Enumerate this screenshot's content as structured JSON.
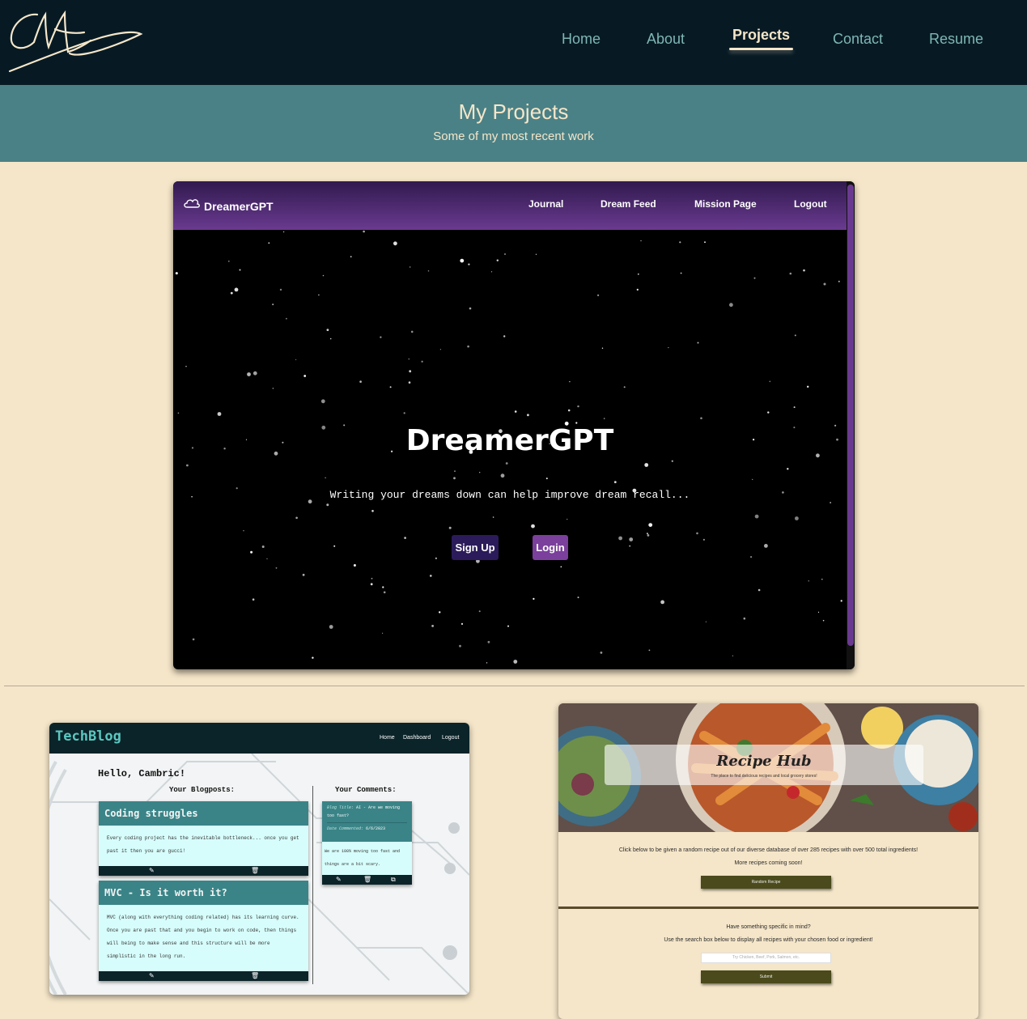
{
  "nav": {
    "logo_alt": "CM",
    "links": [
      {
        "label": "Home"
      },
      {
        "label": "About"
      },
      {
        "label": "Projects",
        "active": true
      },
      {
        "label": "Contact"
      },
      {
        "label": "Resume"
      }
    ]
  },
  "hero": {
    "title": "My Projects",
    "subtitle": "Some of my most recent work"
  },
  "projects": {
    "dreamer": {
      "brand": "DreamerGPT",
      "brand_icon": "cloud-icon",
      "links": [
        "Journal",
        "Dream Feed",
        "Mission Page",
        "Logout"
      ],
      "title": "DreamerGPT",
      "tagline": "Writing your dreams down can help improve dream recall...",
      "signup_label": "Sign Up",
      "login_label": "Login",
      "colors": {
        "nav": "#6a3a90",
        "signup": "#2b1b5a",
        "login": "#7b3f9c"
      }
    },
    "techblog": {
      "brand": "TechBlog",
      "links": [
        "Home",
        "Dashboard",
        "Logout"
      ],
      "greeting": "Hello, Cambric!",
      "posts_heading": "Your Blogposts:",
      "comments_heading": "Your Comments:",
      "posts": [
        {
          "title": "Coding struggles",
          "body": "Every coding project has the inevitable bottleneck... once you get past it then you are gucci!"
        },
        {
          "title": "MVC - Is it worth it?",
          "body": "MVC (along with everything coding related) has its learning curve. Once you are past that and you begin to work on code, then things will being to make sense and this structure will be more simplistic in the long run."
        }
      ],
      "comment": {
        "blog_title_label": "Blog Title:",
        "blog_title": "AI - Are we moving too fast?",
        "date_label": "Date Commented:",
        "date": "6/6/2023",
        "body": "We are 100% moving too fast and things are a bit scary."
      },
      "colors": {
        "brand": "#5cc7c0",
        "post_head": "#3a8487"
      }
    },
    "recipehub": {
      "title": "Recipe Hub",
      "tagline": "The place to find delicious recipes and local grocery stores!",
      "random_text": "Click below to be given a random recipe out of our diverse database of over 285 recipes with over 500 total ingredients!",
      "more_text": "More recipes coming soon!",
      "random_button": "Random Recipe",
      "specific_text": "Have something specific in mind?",
      "search_text": "Use the search box below to display all recipes with your chosen food or ingredient!",
      "search_placeholder": "Try Chicken, Beef, Pork, Salmon, etc.",
      "submit_button": "Submit"
    }
  }
}
